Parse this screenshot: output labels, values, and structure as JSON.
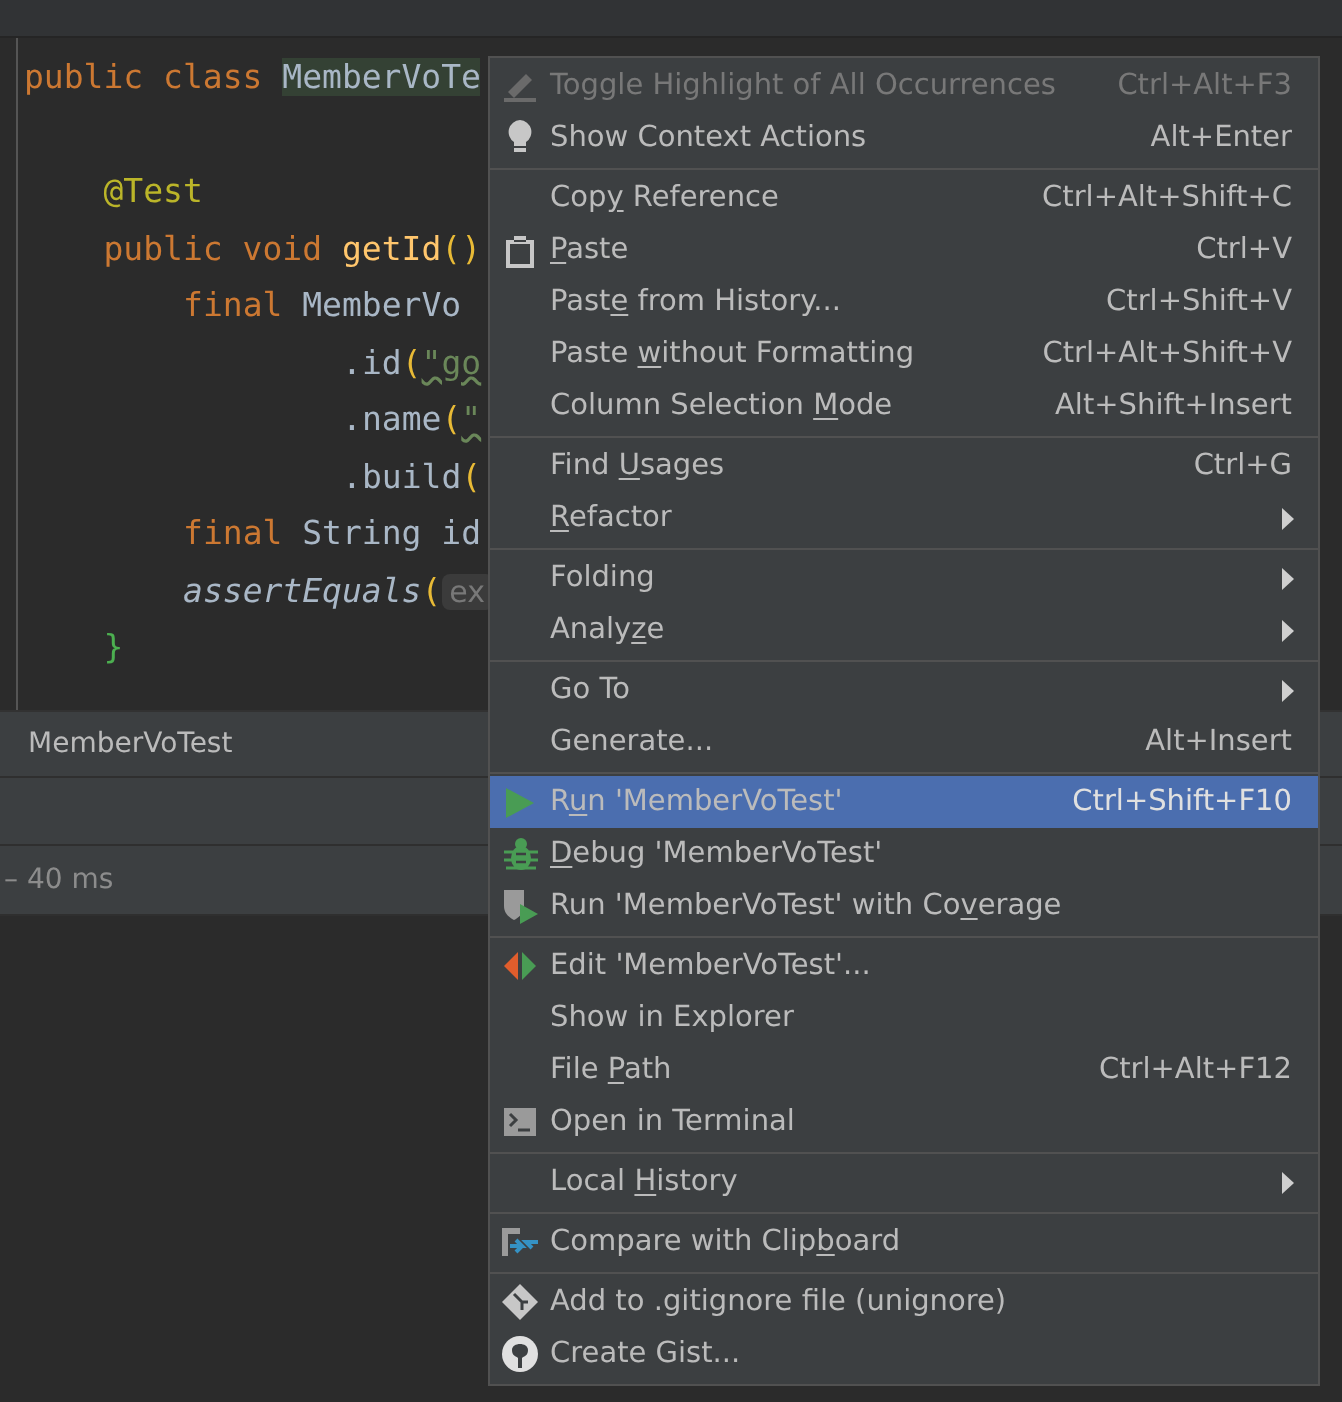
{
  "editor": {
    "lines": [
      {
        "kind": "top",
        "tokens": [
          {
            "kind": "keyword",
            "text": "public class "
          },
          {
            "kind": "highlight",
            "text": "MemberVoTe"
          }
        ]
      },
      {
        "kind": "blank"
      },
      {
        "kind": "member",
        "tokens": [
          {
            "kind": "annotation",
            "text": "@Test"
          }
        ]
      },
      {
        "kind": "member",
        "tokens": [
          {
            "kind": "keyword",
            "text": "public void "
          },
          {
            "kind": "method",
            "text": "getId"
          },
          {
            "kind": "paren",
            "text": "()"
          }
        ]
      },
      {
        "kind": "body",
        "tokens": [
          {
            "kind": "keyword",
            "text": "final "
          },
          {
            "kind": "plain",
            "text": "MemberVo"
          }
        ]
      },
      {
        "kind": "chain",
        "tokens": [
          {
            "kind": "plain",
            "text": ".id"
          },
          {
            "kind": "paren",
            "text": "("
          },
          {
            "kind": "string",
            "text": "\"go"
          }
        ]
      },
      {
        "kind": "chain",
        "tokens": [
          {
            "kind": "plain",
            "text": ".name"
          },
          {
            "kind": "paren",
            "text": "("
          },
          {
            "kind": "string",
            "text": "\""
          }
        ]
      },
      {
        "kind": "chain",
        "tokens": [
          {
            "kind": "plain",
            "text": ".build"
          },
          {
            "kind": "paren",
            "text": "("
          }
        ]
      },
      {
        "kind": "body",
        "tokens": [
          {
            "kind": "keyword",
            "text": "final "
          },
          {
            "kind": "plain",
            "text": "String id"
          }
        ]
      },
      {
        "kind": "body",
        "tokens": [
          {
            "kind": "static",
            "text": "assertEquals"
          },
          {
            "kind": "paren",
            "text": "("
          },
          {
            "kind": "hint",
            "text": "ex"
          }
        ]
      },
      {
        "kind": "member",
        "tokens": [
          {
            "kind": "brace",
            "text": "}"
          }
        ]
      }
    ]
  },
  "run_panel": {
    "tab": "MemberVoTest",
    "duration": "– 40 ms"
  },
  "context_menu": {
    "groups": [
      [
        {
          "label": "Toggle Highlight of All Occurrences",
          "shortcut": "Ctrl+Alt+F3",
          "disabled": true,
          "selected": false,
          "submenu": false
        },
        {
          "label": "Show Context Actions",
          "shortcut": "Alt+Enter",
          "disabled": false,
          "selected": false,
          "submenu": false
        }
      ],
      [
        {
          "before": "Cop",
          "mnemonic": "y",
          "after": " Reference",
          "shortcut": "Ctrl+Alt+Shift+C",
          "disabled": false,
          "selected": false,
          "submenu": false
        },
        {
          "mnemonic": "P",
          "after": "aste",
          "shortcut": "Ctrl+V",
          "disabled": false,
          "selected": false,
          "submenu": false
        },
        {
          "before": "Past",
          "mnemonic": "e",
          "after": " from History...",
          "shortcut": "Ctrl+Shift+V",
          "disabled": false,
          "selected": false,
          "submenu": false
        },
        {
          "before": "Paste ",
          "mnemonic": "w",
          "after": "ithout Formatting",
          "shortcut": "Ctrl+Alt+Shift+V",
          "disabled": false,
          "selected": false,
          "submenu": false
        },
        {
          "before": "Column Selection ",
          "mnemonic": "M",
          "after": "ode",
          "shortcut": "Alt+Shift+Insert",
          "disabled": false,
          "selected": false,
          "submenu": false
        }
      ],
      [
        {
          "before": "Find ",
          "mnemonic": "U",
          "after": "sages",
          "shortcut": "Ctrl+G",
          "disabled": false,
          "selected": false,
          "submenu": false
        },
        {
          "mnemonic": "R",
          "after": "efactor",
          "disabled": false,
          "selected": false,
          "submenu": true
        }
      ],
      [
        {
          "label": "Folding",
          "disabled": false,
          "selected": false,
          "submenu": true
        },
        {
          "before": "Analy",
          "mnemonic": "z",
          "after": "e",
          "disabled": false,
          "selected": false,
          "submenu": true
        }
      ],
      [
        {
          "label": "Go To",
          "disabled": false,
          "selected": false,
          "submenu": true
        },
        {
          "label": "Generate...",
          "shortcut": "Alt+Insert",
          "disabled": false,
          "selected": false,
          "submenu": false
        }
      ],
      [
        {
          "before": "R",
          "mnemonic": "u",
          "after": "n 'MemberVoTest'",
          "shortcut": "Ctrl+Shift+F10",
          "disabled": false,
          "selected": true,
          "submenu": false
        },
        {
          "mnemonic": "D",
          "after": "ebug 'MemberVoTest'",
          "disabled": false,
          "selected": false,
          "submenu": false
        },
        {
          "before": "Run 'MemberVoTest' with Co",
          "mnemonic": "v",
          "after": "erage",
          "disabled": false,
          "selected": false,
          "submenu": false
        }
      ],
      [
        {
          "label": "Edit 'MemberVoTest'...",
          "disabled": false,
          "selected": false,
          "submenu": false
        },
        {
          "label": "Show in Explorer",
          "disabled": false,
          "selected": false,
          "submenu": false
        },
        {
          "before": "File ",
          "mnemonic": "P",
          "after": "ath",
          "shortcut": "Ctrl+Alt+F12",
          "disabled": false,
          "selected": false,
          "submenu": false
        },
        {
          "label": "Open in Terminal",
          "disabled": false,
          "selected": false,
          "submenu": false
        }
      ],
      [
        {
          "before": "Local ",
          "mnemonic": "H",
          "after": "istory",
          "disabled": false,
          "selected": false,
          "submenu": true
        }
      ],
      [
        {
          "before": "Compare with Clip",
          "mnemonic": "b",
          "after": "oard",
          "disabled": false,
          "selected": false,
          "submenu": false
        }
      ],
      [
        {
          "label": "Add to .gitignore file (unignore)",
          "disabled": false,
          "selected": false,
          "submenu": false
        },
        {
          "label": "Create Gist...",
          "disabled": false,
          "selected": false,
          "submenu": false
        }
      ]
    ]
  }
}
